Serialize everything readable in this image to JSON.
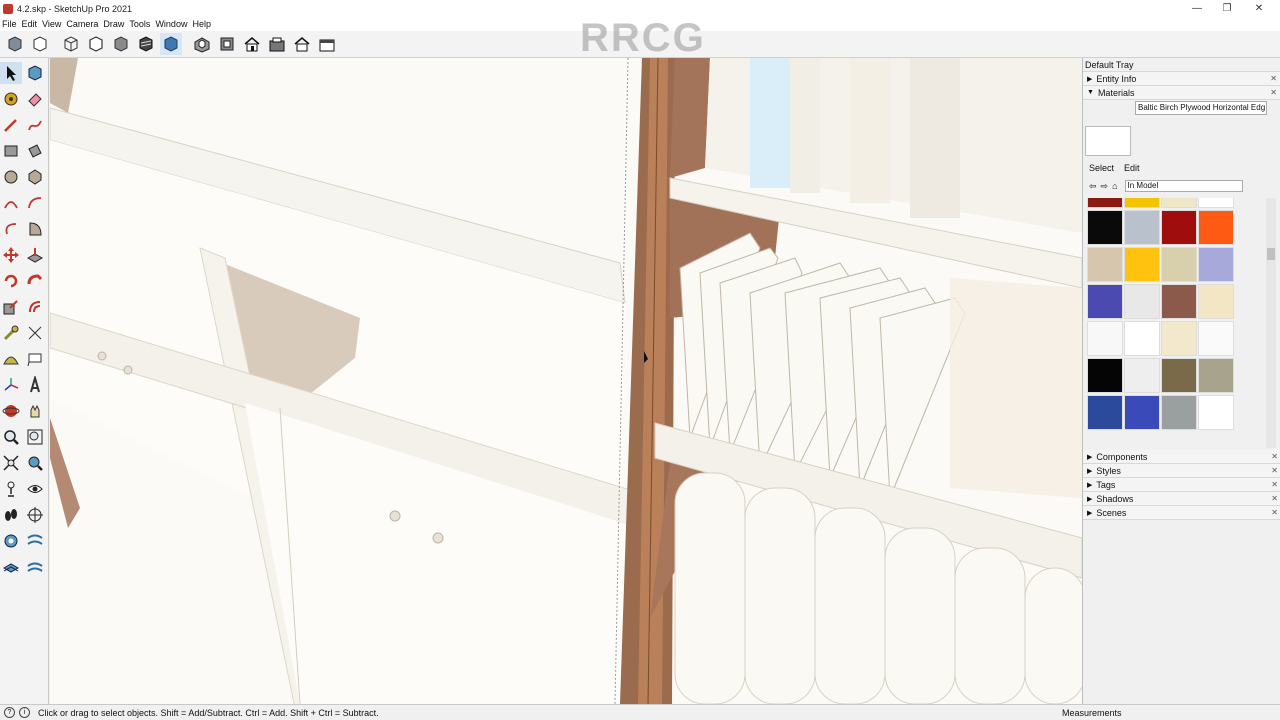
{
  "window": {
    "title": "4.2.skp - SketchUp Pro 2021",
    "minimize": "—",
    "restore": "❐",
    "close": "✕"
  },
  "menu": [
    "File",
    "Edit",
    "View",
    "Camera",
    "Draw",
    "Tools",
    "Window",
    "Help"
  ],
  "toolbar_icons": [
    "iso-view-icon",
    "xray-icon",
    "back-edges-icon",
    "wireframe-icon",
    "hidden-line-icon",
    "shaded-icon",
    "shaded-textures-icon",
    "monochrome-icon",
    "iso-icon",
    "top-icon",
    "front-icon",
    "right-icon",
    "back-icon",
    "left-icon"
  ],
  "watermark": "RRCG",
  "tray": {
    "title": "Default Tray",
    "entity_info": "Entity Info",
    "materials": "Materials",
    "material_name": "Baltic Birch Plywood Horizontal Edg",
    "select_tab": "Select",
    "edit_tab": "Edit",
    "collection": "In Model",
    "panels": [
      "Components",
      "Styles",
      "Tags",
      "Shadows",
      "Scenes"
    ],
    "swatch_colors": [
      "#8a1a12",
      "#f5c400",
      "#efe6c6",
      "#ffffff",
      "#0a0a0a",
      "#b9c2cc",
      "#a00d0d",
      "#ff5a14",
      "#d6c6ae",
      "#ffc20e",
      "#d8cfac",
      "#a6a9d9",
      "#4a4ab0",
      "#e8e8e8",
      "#8b5a4a",
      "#f2e6c4",
      "#f8f8f8",
      "#ffffff",
      "#f2e8cc",
      "#fafafa",
      "#050505",
      "#eeeeee",
      "#7a6a4a",
      "#a8a38c",
      "#2c4a9c",
      "#3a4ab8",
      "#9aa0a0",
      "#ffffff"
    ]
  },
  "status": {
    "text": "Click or drag to select objects. Shift = Add/Subtract. Ctrl = Add. Shift + Ctrl = Subtract.",
    "measurements": "Measurements"
  }
}
